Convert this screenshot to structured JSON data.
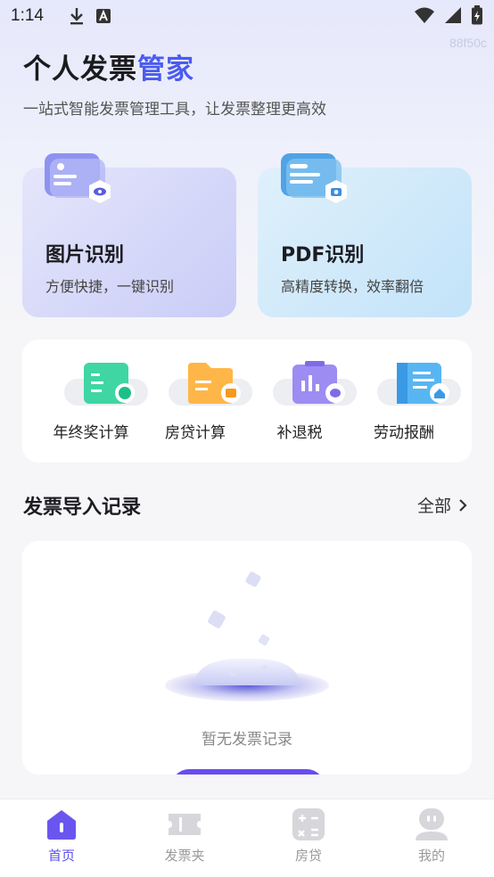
{
  "status": {
    "time": "1:14",
    "watermark": "88f50c"
  },
  "header": {
    "title_main": "个人发票",
    "title_accent": "管家",
    "subtitle": "一站式智能发票管理工具，让发票整理更高效"
  },
  "cards": [
    {
      "title": "图片识别",
      "desc": "方便快捷，一键识别"
    },
    {
      "title": "PDF识别",
      "desc": "高精度转换，效率翻倍"
    }
  ],
  "tools": [
    {
      "label": "年终奖计算"
    },
    {
      "label": "房贷计算"
    },
    {
      "label": "补退税"
    },
    {
      "label": "劳动报酬"
    }
  ],
  "records": {
    "title": "发票导入记录",
    "all_label": "全部",
    "empty_text": "暂无发票记录"
  },
  "tabbar": [
    {
      "label": "首页",
      "icon": "home-icon"
    },
    {
      "label": "发票夹",
      "icon": "ticket-icon"
    },
    {
      "label": "房贷",
      "icon": "calculator-icon"
    },
    {
      "label": "我的",
      "icon": "user-icon"
    }
  ],
  "colors": {
    "accent": "#4a5bf0",
    "active_tab": "#5a50ee",
    "button": "#6a4cf0"
  }
}
